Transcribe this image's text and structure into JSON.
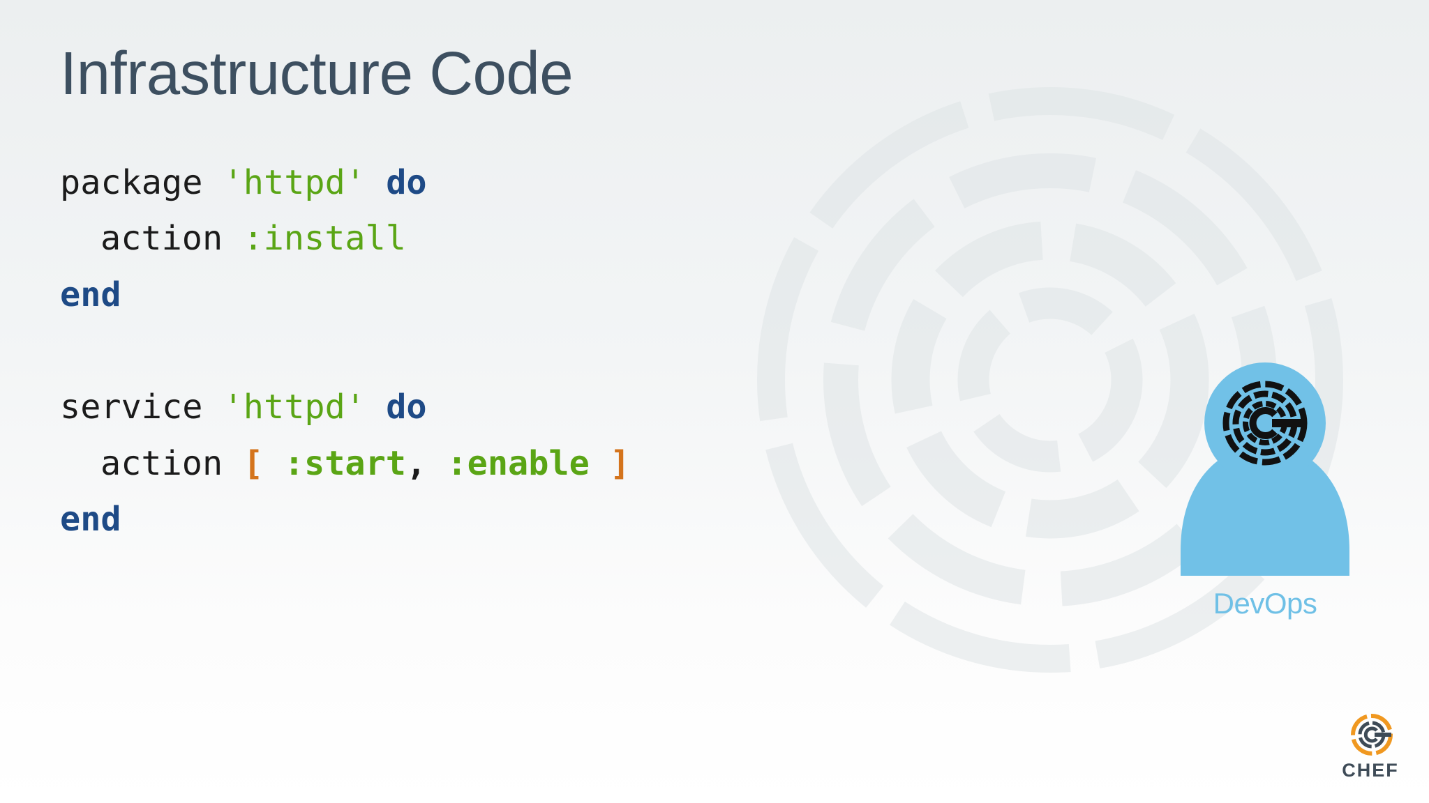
{
  "slide": {
    "title": "Infrastructure Code"
  },
  "code": {
    "block1": {
      "resource": "package",
      "name": "'httpd'",
      "do": "do",
      "action_kw": "action",
      "action_value": ":install",
      "end": "end"
    },
    "block2": {
      "resource": "service",
      "name": "'httpd'",
      "do": "do",
      "action_kw": "action",
      "open_bracket": "[",
      "value1": ":start",
      "comma": ",",
      "value2": ":enable",
      "close_bracket": "]",
      "end": "end"
    }
  },
  "persona": {
    "label": "DevOps",
    "icon": "chef-emblem-icon",
    "color": "#71c1e7"
  },
  "brand": {
    "wordmark": "CHEF",
    "logo_icon": "chef-logo-icon",
    "colors": {
      "orange": "#f09820",
      "slate": "#3e4b57"
    }
  },
  "colors": {
    "title": "#3d4f60",
    "keyword": "#1e4a86",
    "string": "#5aa515",
    "bracket": "#d4741c"
  }
}
